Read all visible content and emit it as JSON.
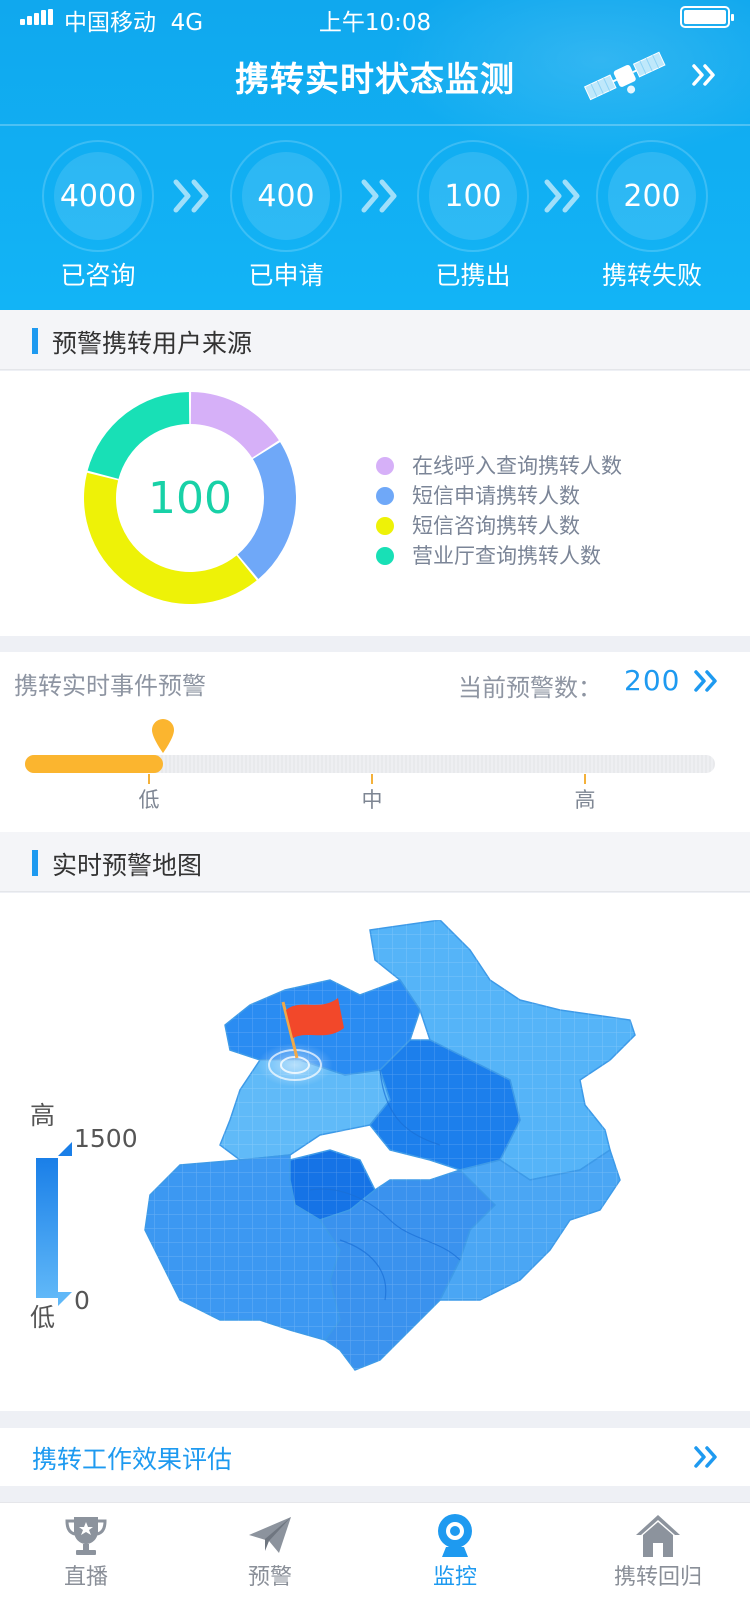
{
  "status_bar": {
    "carrier": "中国移动",
    "network": "4G",
    "time": "上午10:08"
  },
  "header": {
    "title": "携转实时状态监测"
  },
  "funnel": [
    {
      "value": "4000",
      "label": "已咨询"
    },
    {
      "value": "400",
      "label": "已申请"
    },
    {
      "value": "100",
      "label": "已携出"
    },
    {
      "value": "200",
      "label": "携转失败"
    }
  ],
  "source_section": {
    "title": "预警携转用户来源",
    "center_value": "100",
    "legend": [
      {
        "label": "在线呼入查询携转人数",
        "color": "#d6b0f8"
      },
      {
        "label": "短信申请携转人数",
        "color": "#6fa8f8"
      },
      {
        "label": "短信咨询携转人数",
        "color": "#eef207"
      },
      {
        "label": "营业厅查询携转人数",
        "color": "#18e0b6"
      }
    ],
    "chart_data": {
      "type": "pie",
      "center_label": "100",
      "categories": [
        "在线呼入查询携转人数",
        "短信申请携转人数",
        "短信咨询携转人数",
        "营业厅查询携转人数"
      ],
      "values": [
        16,
        23,
        40,
        21
      ]
    }
  },
  "warning": {
    "title": "携转实时事件预警",
    "count_label": "当前预警数：",
    "count": "200",
    "level_fraction": 0.2,
    "levels": [
      "低",
      "中",
      "高"
    ]
  },
  "map_section": {
    "title": "实时预警地图",
    "scale_high_label": "高",
    "scale_low_label": "低",
    "scale_max": "1500",
    "scale_min": "0"
  },
  "evaluation": {
    "label": "携转工作效果评估"
  },
  "tabbar": [
    {
      "label": "直播",
      "icon": "trophy-icon",
      "active": false
    },
    {
      "label": "预警",
      "icon": "paper-plane-icon",
      "active": false
    },
    {
      "label": "监控",
      "icon": "camera-icon",
      "active": true
    },
    {
      "label": "携转回归",
      "icon": "home-icon",
      "active": false
    }
  ],
  "colors": {
    "brand": "#12b0f4",
    "accent": "#1e9af0",
    "warning": "#fbb52f"
  }
}
